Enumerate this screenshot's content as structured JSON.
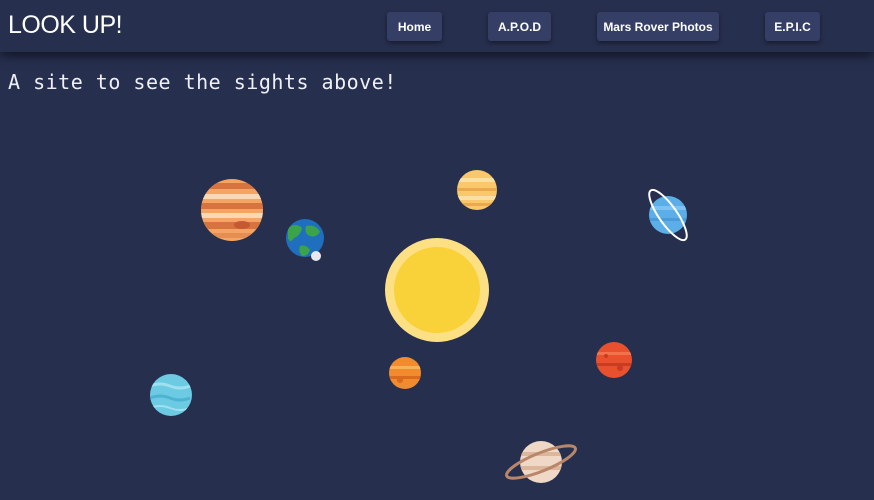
{
  "header": {
    "brand": "LOOK UP!",
    "nav": [
      {
        "label": "Home"
      },
      {
        "label": "A.P.O.D"
      },
      {
        "label": "Mars Rover Photos"
      },
      {
        "label": "E.P.I.C"
      }
    ]
  },
  "main": {
    "tagline": "A site to see the sights above!"
  },
  "colors": {
    "background": "#272f4f",
    "nav_button": "#353f65",
    "sun": "#f9d138",
    "sun_glow": "#fde083"
  }
}
